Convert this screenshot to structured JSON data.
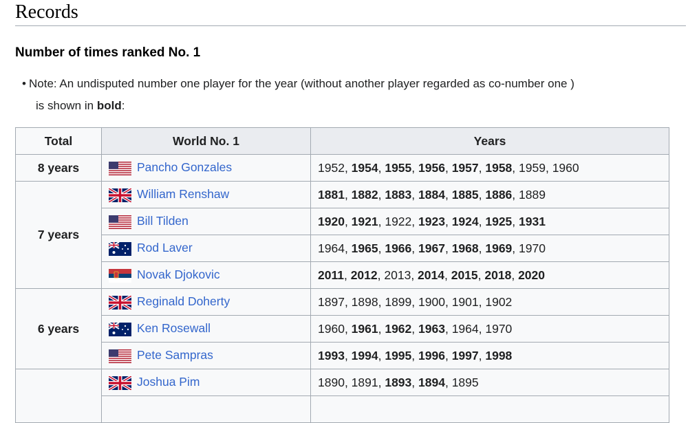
{
  "section": {
    "title": "Records"
  },
  "subsection": {
    "title": "Number of times ranked No. 1"
  },
  "note": {
    "bullet": "•",
    "prefix": "Note: An undisputed number one player for the year (without another player regarded as co-number one )",
    "line2_prefix": "is shown in ",
    "bold_word": "bold",
    "suffix": ":"
  },
  "table": {
    "headers": [
      "Total",
      "World No. 1",
      "Years"
    ],
    "groups": [
      {
        "total": "8 years",
        "players": [
          {
            "name": "Pancho Gonzales",
            "flag": "us-flag-icon",
            "years": [
              [
                "1952",
                false
              ],
              [
                "1954",
                true
              ],
              [
                "1955",
                true
              ],
              [
                "1956",
                true
              ],
              [
                "1957",
                true
              ],
              [
                "1958",
                true
              ],
              [
                "1959",
                false
              ],
              [
                "1960",
                false
              ]
            ]
          }
        ]
      },
      {
        "total": "7 years",
        "players": [
          {
            "name": "William Renshaw",
            "flag": "uk-flag-icon",
            "years": [
              [
                "1881",
                true
              ],
              [
                "1882",
                true
              ],
              [
                "1883",
                true
              ],
              [
                "1884",
                true
              ],
              [
                "1885",
                true
              ],
              [
                "1886",
                true
              ],
              [
                "1889",
                false
              ]
            ]
          },
          {
            "name": "Bill Tilden",
            "flag": "us-flag-icon",
            "years": [
              [
                "1920",
                true
              ],
              [
                "1921",
                true
              ],
              [
                "1922",
                false
              ],
              [
                "1923",
                true
              ],
              [
                "1924",
                true
              ],
              [
                "1925",
                true
              ],
              [
                "1931",
                true
              ]
            ]
          },
          {
            "name": "Rod Laver",
            "flag": "au-flag-icon",
            "years": [
              [
                "1964",
                false
              ],
              [
                "1965",
                true
              ],
              [
                "1966",
                true
              ],
              [
                "1967",
                true
              ],
              [
                "1968",
                true
              ],
              [
                "1969",
                true
              ],
              [
                "1970",
                false
              ]
            ]
          },
          {
            "name": "Novak Djokovic",
            "flag": "rs-flag-icon",
            "years": [
              [
                "2011",
                true
              ],
              [
                "2012",
                true
              ],
              [
                "2013",
                false
              ],
              [
                "2014",
                true
              ],
              [
                "2015",
                true
              ],
              [
                "2018",
                true
              ],
              [
                "2020",
                true
              ]
            ]
          }
        ]
      },
      {
        "total": "6 years",
        "players": [
          {
            "name": "Reginald Doherty",
            "flag": "uk-flag-icon",
            "years": [
              [
                "1897",
                false
              ],
              [
                "1898",
                false
              ],
              [
                "1899",
                false
              ],
              [
                "1900",
                false
              ],
              [
                "1901",
                false
              ],
              [
                "1902",
                false
              ]
            ]
          },
          {
            "name": "Ken Rosewall",
            "flag": "au-flag-icon",
            "years": [
              [
                "1960",
                false
              ],
              [
                "1961",
                true
              ],
              [
                "1962",
                true
              ],
              [
                "1963",
                true
              ],
              [
                "1964",
                false
              ],
              [
                "1970",
                false
              ]
            ]
          },
          {
            "name": "Pete Sampras",
            "flag": "us-flag-icon",
            "years": [
              [
                "1993",
                true
              ],
              [
                "1994",
                true
              ],
              [
                "1995",
                true
              ],
              [
                "1996",
                true
              ],
              [
                "1997",
                true
              ],
              [
                "1998",
                true
              ]
            ]
          }
        ]
      },
      {
        "total": "",
        "players": [
          {
            "name": "Joshua Pim",
            "flag": "uk-flag-icon",
            "years": [
              [
                "1890",
                false
              ],
              [
                "1891",
                false
              ],
              [
                "1893",
                true
              ],
              [
                "1894",
                true
              ],
              [
                "1895",
                false
              ]
            ]
          },
          {
            "name": "",
            "flag": "",
            "years": []
          }
        ]
      }
    ]
  },
  "colors": {
    "link": "#3366cc",
    "border": "#a2a9b1",
    "header_bg": "#eaecf0",
    "cell_bg": "#f8f9fa"
  }
}
